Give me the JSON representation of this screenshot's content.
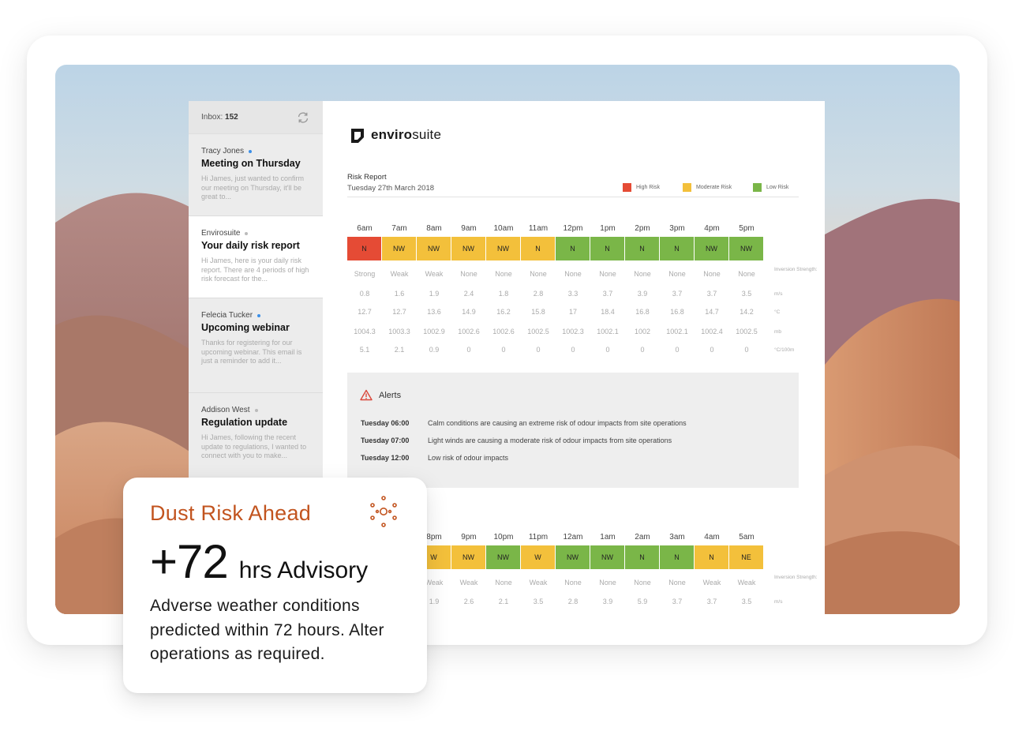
{
  "inbox": {
    "label": "Inbox:",
    "count": "152"
  },
  "emails": [
    {
      "sender": "Tracy Jones",
      "subject": "Meeting on Thursday",
      "preview": "Hi James, just wanted to confirm our meeting on Thursday, it'll be great to...",
      "unread": true
    },
    {
      "sender": "Envirosuite",
      "subject": "Your daily risk report",
      "preview": "Hi James, here is your daily risk report. There are 4 periods of high risk forecast for the...",
      "unread": false
    },
    {
      "sender": "Felecia Tucker",
      "subject": "Upcoming webinar",
      "preview": "Thanks for registering for our upcoming webinar. This email is just a reminder to add it...",
      "unread": true
    },
    {
      "sender": "Addison West",
      "subject": "Regulation update",
      "preview": "Hi James, following the recent update to regulations, I wanted to connect with you to make...",
      "unread": false
    }
  ],
  "report": {
    "logo_bold": "enviro",
    "logo_light": "suite",
    "title": "Risk Report",
    "date": "Tuesday 27th March 2018",
    "legend": [
      {
        "label": "High Risk",
        "color": "#e54b35"
      },
      {
        "label": "Moderate Risk",
        "color": "#f3c03b"
      },
      {
        "label": "Low Risk",
        "color": "#7ab648"
      }
    ],
    "day": {
      "hours": [
        "6am",
        "7am",
        "8am",
        "9am",
        "10am",
        "11am",
        "12pm",
        "1pm",
        "2pm",
        "3pm",
        "4pm",
        "5pm"
      ],
      "directions": [
        "N",
        "NW",
        "NW",
        "NW",
        "NW",
        "N",
        "N",
        "N",
        "N",
        "N",
        "NW",
        "NW"
      ],
      "risk": [
        "high",
        "moderate",
        "moderate",
        "moderate",
        "moderate",
        "moderate",
        "low",
        "low",
        "low",
        "low",
        "low",
        "low"
      ],
      "inversion": [
        "Strong",
        "Weak",
        "Weak",
        "None",
        "None",
        "None",
        "None",
        "None",
        "None",
        "None",
        "None",
        "None"
      ],
      "wind": [
        "0.8",
        "1.6",
        "1.9",
        "2.4",
        "1.8",
        "2.8",
        "3.3",
        "3.7",
        "3.9",
        "3.7",
        "3.7",
        "3.5"
      ],
      "temp": [
        "12.7",
        "12.7",
        "13.6",
        "14.9",
        "16.2",
        "15.8",
        "17",
        "18.4",
        "16.8",
        "16.8",
        "14.7",
        "14.2"
      ],
      "pressure": [
        "1004.3",
        "1003.3",
        "1002.9",
        "1002.6",
        "1002.6",
        "1002.5",
        "1002.3",
        "1002.1",
        "1002",
        "1002.1",
        "1002.4",
        "1002.5"
      ],
      "lapse": [
        "5.1",
        "2.1",
        "0.9",
        "0",
        "0",
        "0",
        "0",
        "0",
        "0",
        "0",
        "0",
        "0"
      ]
    },
    "units": {
      "inversion": "Inversion Strength:",
      "wind": "m/s",
      "temp": "°C",
      "pressure": "mb",
      "lapse": "°C/100m"
    },
    "alerts_title": "Alerts",
    "alerts": [
      {
        "time": "Tuesday 06:00",
        "message": "Calm conditions are causing an extreme risk of odour impacts from site operations"
      },
      {
        "time": "Tuesday 07:00",
        "message": "Light winds are causing a moderate risk of odour impacts from site operations"
      },
      {
        "time": "Tuesday 12:00",
        "message": "Low risk of odour impacts"
      }
    ],
    "night": {
      "hours": [
        "8pm",
        "9pm",
        "10pm",
        "11pm",
        "12am",
        "1am",
        "2am",
        "3am",
        "4am",
        "5am"
      ],
      "directions": [
        "W",
        "NW",
        "NW",
        "W",
        "NW",
        "NW",
        "N",
        "N",
        "N",
        "NE"
      ],
      "risk": [
        "moderate",
        "moderate",
        "low",
        "moderate",
        "low",
        "low",
        "low",
        "low",
        "moderate",
        "moderate"
      ],
      "inversion": [
        "Weak",
        "Weak",
        "None",
        "Weak",
        "None",
        "None",
        "None",
        "None",
        "Weak",
        "Weak"
      ],
      "wind": [
        "1.9",
        "2.6",
        "2.1",
        "3.5",
        "2.8",
        "3.9",
        "5.9",
        "3.7",
        "3.7",
        "3.5"
      ]
    }
  },
  "advisory": {
    "title": "Dust Risk Ahead",
    "number": "+72",
    "unit": "hrs Advisory",
    "description": "Adverse weather conditions predicted within 72 hours. Alter operations as required.",
    "accent": "#c2541f"
  }
}
